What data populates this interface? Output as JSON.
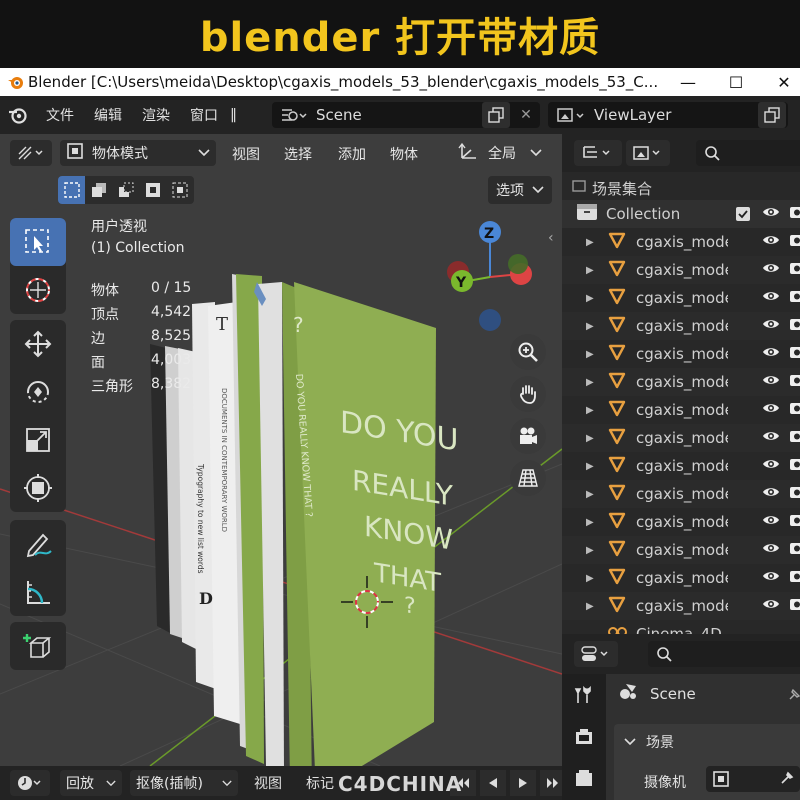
{
  "banner": {
    "title": "blender 打开带材质"
  },
  "window": {
    "title": "Blender [C:\\Users\\meida\\Desktop\\cgaxis_models_53_blender\\cgaxis_models_53_C...",
    "minimize": "—",
    "maximize": "☐",
    "close": "✕"
  },
  "topbar": {
    "menus": [
      "文件",
      "编辑",
      "渲染",
      "窗口"
    ],
    "more": "‖",
    "scene": "Scene",
    "view_layer": "ViewLayer"
  },
  "viewport": {
    "mode": "物体模式",
    "menus": [
      "视图",
      "选择",
      "添加",
      "物体"
    ],
    "transform": "全局",
    "options": "选项",
    "overlay": {
      "view_name": "用户透视",
      "collection": "(1) Collection",
      "stats": [
        {
          "label": "物体",
          "value": "0 / 15"
        },
        {
          "label": "顶点",
          "value": "4,542"
        },
        {
          "label": "边",
          "value": "8,525"
        },
        {
          "label": "面",
          "value": "4,003"
        },
        {
          "label": "三角形",
          "value": "8,382"
        }
      ]
    },
    "gizmo": {
      "z": "Z",
      "y": "Y"
    },
    "book_text": {
      "cover": [
        "DO YOU",
        "REALLY",
        "KNOW",
        "THAT",
        "?"
      ],
      "spine_main": "DO YOU REALLY KNOW THAT ?",
      "spine_q": "?",
      "spine_t": "T",
      "spine_typo": "Typography to new list words",
      "spine_design": "DOCUMENTS IN CONTEMPORARY WORLD",
      "spine_d": "D"
    }
  },
  "timeline": {
    "playback": "回放",
    "keying": "抠像(插帧)",
    "view": "视图",
    "marker": "标记"
  },
  "watermark": "C4DCHINA",
  "outliner": {
    "scene_collection": "场景集合",
    "collection": "Collection",
    "items": [
      "cgaxis_mode",
      "cgaxis_mode",
      "cgaxis_mode",
      "cgaxis_mode",
      "cgaxis_mode",
      "cgaxis_mode",
      "cgaxis_mode",
      "cgaxis_mode",
      "cgaxis_mode",
      "cgaxis_mode",
      "cgaxis_mode",
      "cgaxis_mode",
      "cgaxis_mode",
      "cgaxis_mode"
    ],
    "last_item": "Cinema_4D"
  },
  "properties": {
    "scene_name": "Scene",
    "section": "场景",
    "camera_label": "摄像机"
  },
  "colors": {
    "accent": "#4772b3",
    "book_green": "#8fae52",
    "outliner_icon": "#e8a040",
    "banner_text": "#f2c51d"
  }
}
